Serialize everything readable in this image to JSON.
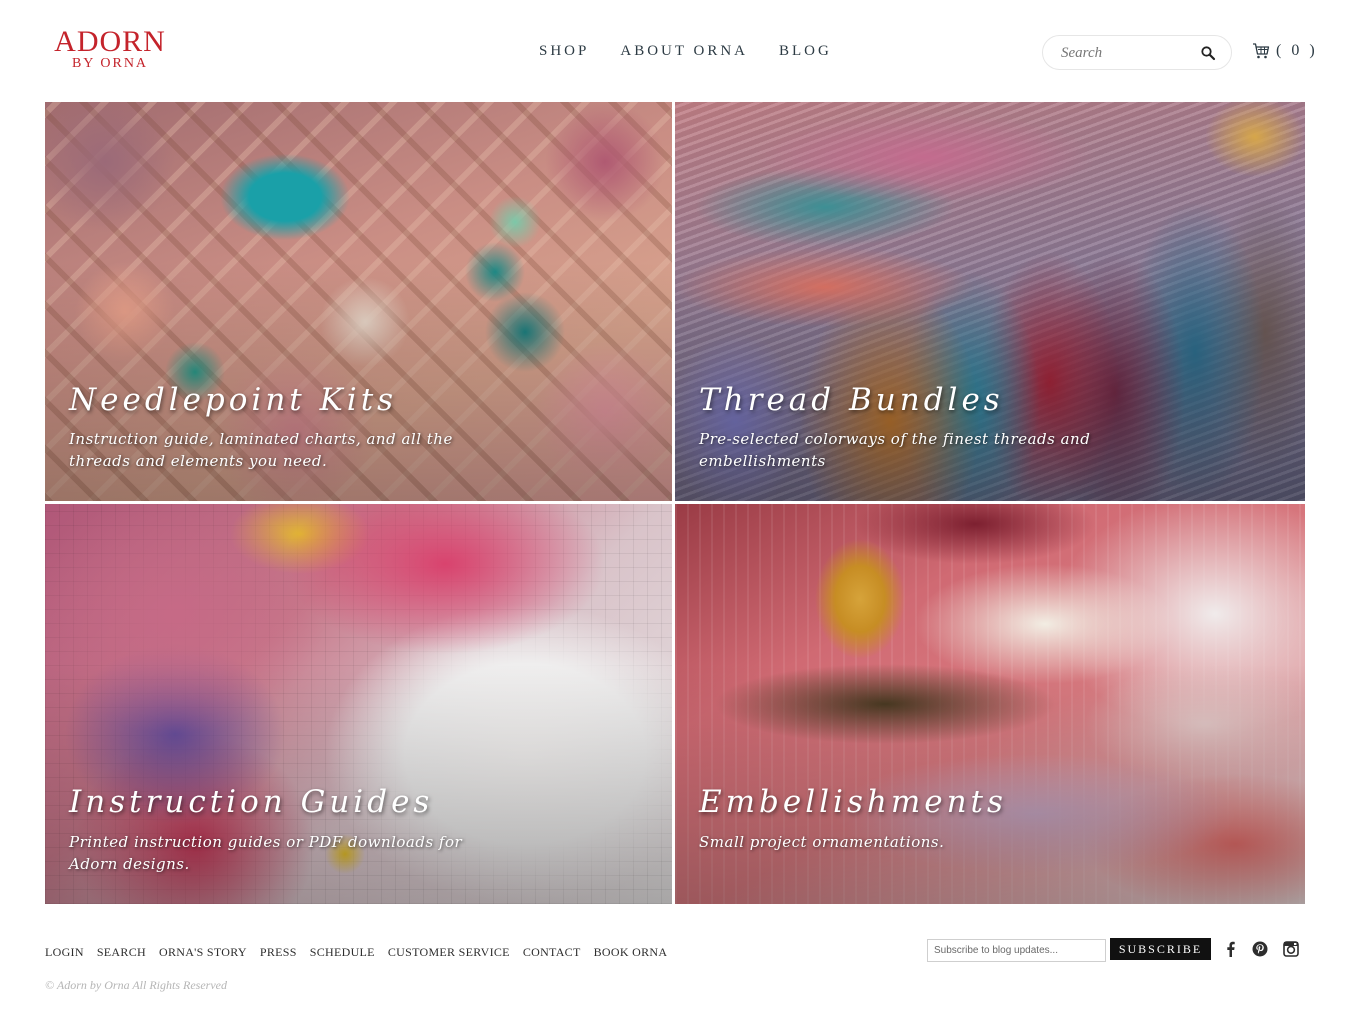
{
  "brand": {
    "logo_main": "ADORN",
    "logo_sub": "BY ORNA",
    "color": "#c4232b"
  },
  "nav": {
    "items": [
      {
        "label": "SHOP"
      },
      {
        "label": "ABOUT ORNA"
      },
      {
        "label": "BLOG"
      }
    ]
  },
  "search": {
    "placeholder": "Search",
    "icon": "search-icon"
  },
  "cart": {
    "icon": "cart-icon",
    "count_label": "( 0 )"
  },
  "tiles": [
    {
      "title": "Needlepoint Kits",
      "description": "Instruction guide, laminated charts, and all the threads and elements you need."
    },
    {
      "title": "Thread Bundles",
      "description": "Pre-selected colorways of the finest threads and embellishments"
    },
    {
      "title": "Instruction Guides",
      "description": "Printed instruction guides or PDF downloads for Adorn designs."
    },
    {
      "title": "Embellishments",
      "description": "Small project ornamentations."
    }
  ],
  "footer": {
    "links": [
      {
        "label": "LOGIN"
      },
      {
        "label": "SEARCH"
      },
      {
        "label": "ORNA'S STORY"
      },
      {
        "label": "PRESS"
      },
      {
        "label": "SCHEDULE"
      },
      {
        "label": "CUSTOMER SERVICE"
      },
      {
        "label": "CONTACT"
      },
      {
        "label": "BOOK ORNA"
      }
    ],
    "subscribe_placeholder": "Subscribe to blog updates...",
    "subscribe_label": "SUBSCRIBE",
    "social_icons": [
      "facebook-icon",
      "pinterest-icon",
      "instagram-icon"
    ],
    "copyright": "© Adorn by Orna All Rights Reserved"
  }
}
